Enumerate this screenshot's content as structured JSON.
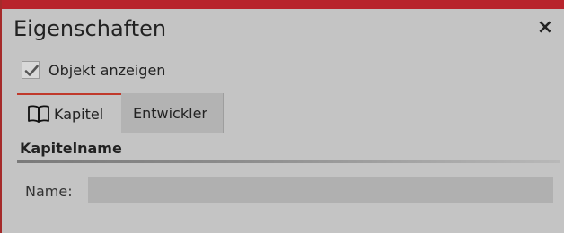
{
  "window": {
    "title": "Eigenschaften",
    "close_label": "×",
    "accent_color": "#b8242c"
  },
  "show_object": {
    "label": "Objekt anzeigen",
    "checked": true
  },
  "tabs": [
    {
      "label": "Kapitel",
      "icon": "book-icon",
      "active": true
    },
    {
      "label": "Entwickler",
      "active": false
    }
  ],
  "section": {
    "title": "Kapitelname"
  },
  "name_field": {
    "label": "Name:",
    "value": "",
    "placeholder": ""
  }
}
